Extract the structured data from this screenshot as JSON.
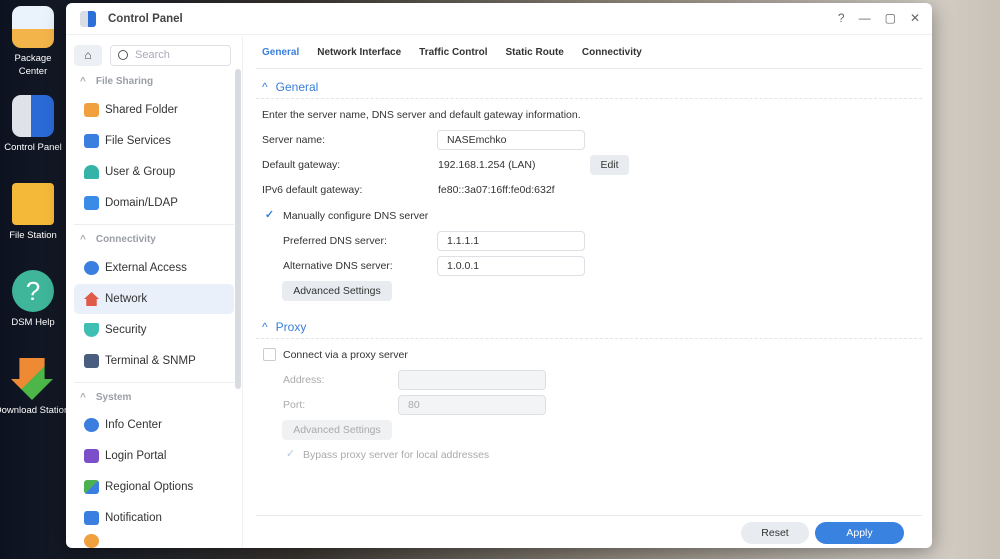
{
  "desktop": [
    "Package Center",
    "Control Panel",
    "File Station",
    "DSM Help",
    "Download Station"
  ],
  "window": {
    "title": "Control Panel",
    "help": "?",
    "minimize": "—",
    "maximize": "▢",
    "close": "✕"
  },
  "sidebar": {
    "search_placeholder": "Search",
    "sections": [
      "File Sharing",
      "Connectivity",
      "System"
    ],
    "items": [
      "Shared Folder",
      "File Services",
      "User & Group",
      "Domain/LDAP",
      "External Access",
      "Network",
      "Security",
      "Terminal & SNMP",
      "Info Center",
      "Login Portal",
      "Regional Options",
      "Notification"
    ]
  },
  "tabs": [
    "General",
    "Network Interface",
    "Traffic Control",
    "Static Route",
    "Connectivity"
  ],
  "general": {
    "heading": "General",
    "description": "Enter the server name, DNS server and default gateway information.",
    "server_name_label": "Server name:",
    "server_name": "NASEmchko",
    "gateway_label": "Default gateway:",
    "gateway": "192.168.1.254 (LAN)",
    "edit": "Edit",
    "ipv6_label": "IPv6 default gateway:",
    "ipv6": "fe80::3a07:16ff:fe0d:632f",
    "manual_dns_label": "Manually configure DNS server",
    "preferred_label": "Preferred DNS server:",
    "preferred": "1.1.1.1",
    "alternative_label": "Alternative DNS server:",
    "alternative": "1.0.0.1",
    "advanced": "Advanced Settings"
  },
  "proxy": {
    "heading": "Proxy",
    "connect_label": "Connect via a proxy server",
    "address_label": "Address:",
    "address": "",
    "port_label": "Port:",
    "port": "80",
    "advanced": "Advanced Settings",
    "bypass_label": "Bypass proxy server for local addresses"
  },
  "footer": {
    "reset": "Reset",
    "apply": "Apply"
  },
  "colors": {
    "accent": "#3a7fd9"
  }
}
